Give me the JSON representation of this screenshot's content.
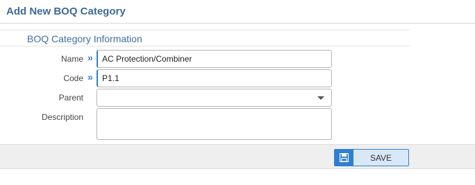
{
  "header": {
    "title": "Add New BOQ Category"
  },
  "section": {
    "title": "BOQ Category Information"
  },
  "form": {
    "name": {
      "label": "Name",
      "value": "AC Protection/Combiner",
      "required_marker": "»"
    },
    "code": {
      "label": "Code",
      "value": "P1.1",
      "required_marker": "»"
    },
    "parent": {
      "label": "Parent",
      "value": ""
    },
    "description": {
      "label": "Description",
      "value": ""
    }
  },
  "footer": {
    "save_label": "SAVE"
  },
  "colors": {
    "accent": "#2f7fd1",
    "title": "#3e6a96"
  },
  "icons": {
    "save": "floppy-disk-icon",
    "dropdown": "chevron-down-icon"
  }
}
